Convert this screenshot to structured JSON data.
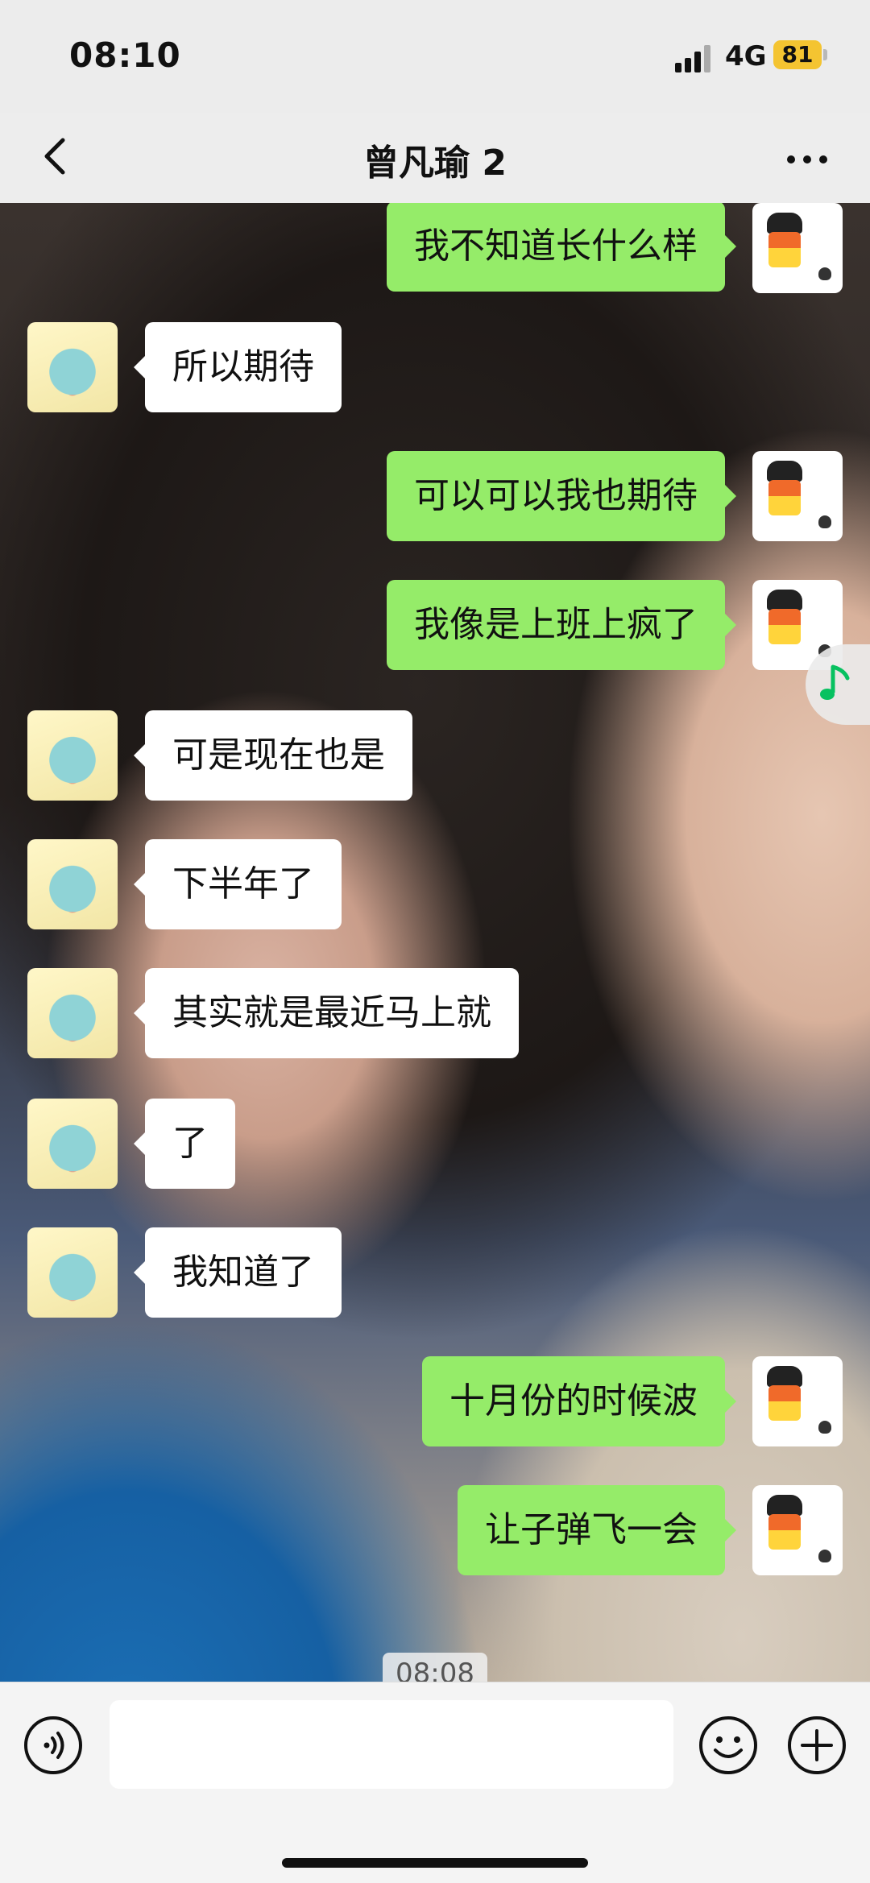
{
  "status_bar": {
    "time": "08:10",
    "network": "4G",
    "battery": "81"
  },
  "header": {
    "title": "曾凡瑜 2"
  },
  "messages": [
    {
      "side": "right",
      "text": "我不知道长什么样"
    },
    {
      "side": "left",
      "text": "所以期待"
    },
    {
      "side": "right",
      "text": "可以可以我也期待"
    },
    {
      "side": "right",
      "text": "我像是上班上疯了"
    },
    {
      "side": "left",
      "text": "可是现在也是"
    },
    {
      "side": "left",
      "text": "下半年了"
    },
    {
      "side": "left",
      "text": "其实就是最近马上就"
    },
    {
      "side": "left",
      "text": "了"
    },
    {
      "side": "left",
      "text": "我知道了"
    },
    {
      "side": "right",
      "text": "十月份的时候波"
    },
    {
      "side": "right",
      "text": "让子弹飞一会"
    }
  ],
  "timestamp": "08:08",
  "colors": {
    "sent_bubble": "#95ec69",
    "received_bubble": "#ffffff",
    "accent_music": "#07c160"
  },
  "icons": {
    "back": "chevron-left-icon",
    "more": "more-dots-icon",
    "voice": "voice-icon",
    "emoji": "emoji-icon",
    "plus": "plus-icon",
    "music": "music-note-icon"
  }
}
